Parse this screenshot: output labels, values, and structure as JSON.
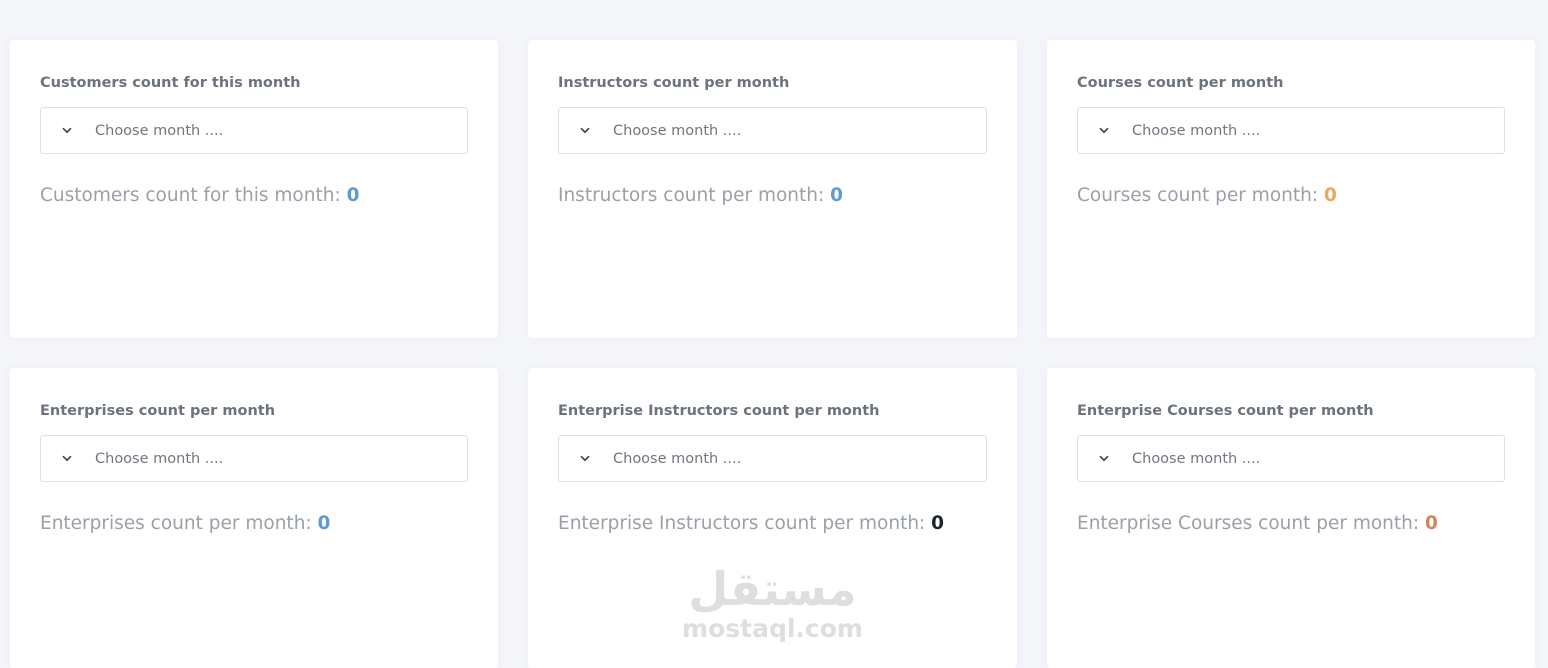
{
  "colors": {
    "blue": "#5b9bd1",
    "orange": "#e8a95e",
    "dark": "#1f2429",
    "red": "#d4835e"
  },
  "cards": [
    {
      "title": "Customers count for this month",
      "select_placeholder": "Choose month ....",
      "count_label": "Customers count for this month:",
      "count_value": "0",
      "value_color": "#5b9bd1"
    },
    {
      "title": "Instructors count per month",
      "select_placeholder": "Choose month ....",
      "count_label": "Instructors count per month:",
      "count_value": "0",
      "value_color": "#5b9bd1"
    },
    {
      "title": "Courses count per month",
      "select_placeholder": "Choose month ....",
      "count_label": "Courses count per month:",
      "count_value": "0",
      "value_color": "#e8a95e"
    },
    {
      "title": "Enterprises count per month",
      "select_placeholder": "Choose month ....",
      "count_label": "Enterprises count per month:",
      "count_value": "0",
      "value_color": "#5b9bd1"
    },
    {
      "title": "Enterprise Instructors count per month",
      "select_placeholder": "Choose month ....",
      "count_label": "Enterprise Instructors count per month:",
      "count_value": "0",
      "value_color": "#1f2429"
    },
    {
      "title": "Enterprise Courses count per month",
      "select_placeholder": "Choose month ....",
      "count_label": "Enterprise Courses count per month:",
      "count_value": "0",
      "value_color": "#d4835e"
    }
  ],
  "watermark": {
    "arabic": "مستقل",
    "latin": "mostaql.com"
  }
}
